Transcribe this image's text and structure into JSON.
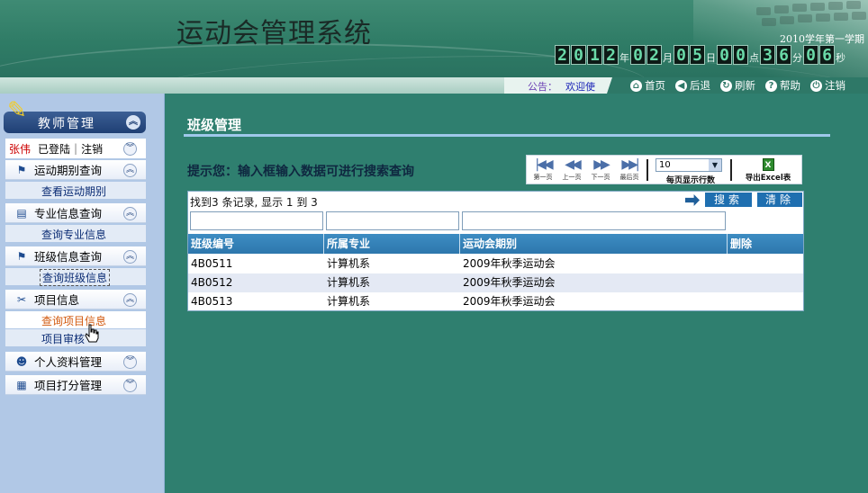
{
  "app": {
    "title": "运动会管理系统",
    "term": "2010学年第一学期",
    "clock": {
      "digits": [
        "2",
        "0",
        "1",
        "2",
        "0",
        "2",
        "0",
        "5",
        "0",
        "0",
        "3",
        "6",
        "0",
        "6"
      ],
      "units": {
        "year": "年",
        "month": "月",
        "day": "日",
        "hour": "点",
        "minute": "分",
        "second": "秒"
      }
    }
  },
  "topbar": {
    "notice_label": "公告：",
    "notice_text": "欢迎使",
    "nav": {
      "home": "首页",
      "back": "后退",
      "refresh": "刷新",
      "help": "帮助",
      "logout": "注销"
    }
  },
  "sidebar": {
    "header": "教师管理",
    "user": {
      "name": "张伟",
      "status": "已登陆",
      "separator": "|",
      "logout": "注销"
    },
    "groups": [
      {
        "label": "运动期别查询",
        "icon": "flag-icon",
        "sub": [
          "查看运动期别"
        ]
      },
      {
        "label": "专业信息查询",
        "icon": "card-icon",
        "sub": [
          "查询专业信息"
        ]
      },
      {
        "label": "班级信息查询",
        "icon": "flag-icon",
        "sub": [
          "查询班级信息"
        ]
      },
      {
        "label": "项目信息",
        "icon": "tools-icon",
        "sub": [
          "查询项目信息",
          "项目审核"
        ]
      },
      {
        "label": "个人资料管理",
        "icon": "user-icon",
        "sub": []
      },
      {
        "label": "项目打分管理",
        "icon": "score-icon",
        "sub": []
      }
    ]
  },
  "main": {
    "page_title": "班级管理",
    "hint": "提示您：输入框输入数据可进行搜索查询",
    "pager": {
      "first": "第一页",
      "prev": "上一页",
      "next": "下一页",
      "last": "最后页",
      "page_size_value": "10",
      "page_size_label": "每页显示行数",
      "export_label": "导出Excel表"
    },
    "grid": {
      "status": "找到3 条记录, 显示 1 到 3",
      "search_button": "搜索",
      "clear_button": "清除",
      "columns": [
        "班级编号",
        "所属专业",
        "运动会期别",
        "删除"
      ],
      "rows": [
        [
          "4B0511",
          "计算机系",
          "2009年秋季运动会",
          ""
        ],
        [
          "4B0512",
          "计算机系",
          "2009年秋季运动会",
          ""
        ],
        [
          "4B0513",
          "计算机系",
          "2009年秋季运动会",
          ""
        ]
      ]
    }
  },
  "colors": {
    "header_green": "#2f7c66",
    "background_teal": "#2f7f6f",
    "sidebar_blue": "#b1c8e6",
    "grid_header_blue": "#2d77ad",
    "user_red": "#cc0000",
    "active_orange": "#d2590e"
  }
}
